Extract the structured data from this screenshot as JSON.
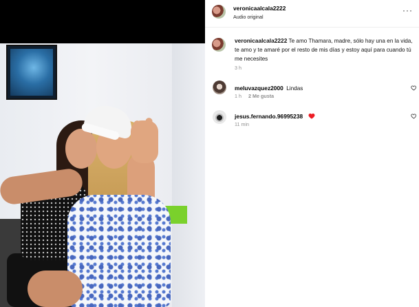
{
  "post": {
    "author": "veronicaalcala2222",
    "audio": "Audio original",
    "more_label": "···"
  },
  "caption": {
    "username": "veronicaalcala2222",
    "text": "Te amo Thamara, madre, sólo hay una en la vida, te amo y te amaré por el resto de mis días y estoy aquí para cuando tú me necesites",
    "time": "3 h"
  },
  "comments": [
    {
      "username": "meluvazquez2000",
      "text": "Lindas",
      "time": "1 h",
      "likes": "2 Me gusta"
    },
    {
      "username": "jesus.fernando.96995238",
      "text": "",
      "time": "11 min"
    }
  ],
  "colors": {
    "heart_red": "#ed1c24",
    "meta_gray": "#8e8e8e"
  },
  "icons": [
    "more-options-icon",
    "heart-outline-icon",
    "red-heart-emoji"
  ]
}
